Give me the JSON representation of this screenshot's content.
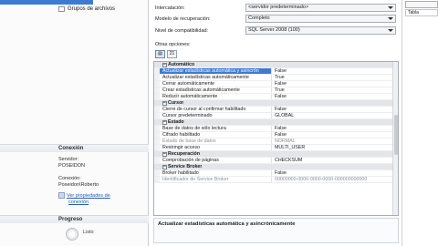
{
  "left": {
    "pages": [
      {
        "label": "",
        "selected": true
      },
      {
        "label": "Grupos de archivos",
        "selected": false
      }
    ],
    "connection": {
      "heading": "Conexión",
      "server_label": "Servidor:",
      "server_value": "POSEIDON",
      "conn_label": "Conexión:",
      "conn_value": "Poseidon\\Roberto",
      "view_props_link_line1": "Ver propiedades de",
      "view_props_link_line2": "conexión"
    },
    "progress": {
      "heading": "Progreso",
      "status": "Listo"
    }
  },
  "fields": {
    "collation_label": "Intercalación:",
    "collation_value": "<servidor predeterminado>",
    "recovery_label": "Modelo de recuperación:",
    "recovery_value": "Completo",
    "compat_label": "Nivel de compatibilidad:",
    "compat_value": "SQL Server 2008 (100)",
    "other_options_label": "Otras opciones:"
  },
  "toolbar": {
    "categorized_icon_label": "",
    "alpha_sort_label": "21"
  },
  "grid": {
    "sections": [
      {
        "title": "Automático",
        "rows": [
          {
            "name": "Actualizar estadísticas automática y asincrón",
            "value": "False",
            "selected": true
          },
          {
            "name": "Actualizar estadísticas automáticamente",
            "value": "True"
          },
          {
            "name": "Cerrar automáticamente",
            "value": "False"
          },
          {
            "name": "Crear estadísticas automáticamente",
            "value": "True"
          },
          {
            "name": "Reducir automáticamente",
            "value": "False"
          }
        ]
      },
      {
        "title": "Cursor",
        "rows": [
          {
            "name": "Cierre de cursor al confirmar habilitado",
            "value": "False"
          },
          {
            "name": "Cursor predeterminado",
            "value": "GLOBAL"
          }
        ]
      },
      {
        "title": "Estado",
        "rows": [
          {
            "name": "Base de datos de sólo lectura",
            "value": "False"
          },
          {
            "name": "Cifrado habilitado",
            "value": "False"
          },
          {
            "name": "Estado de base de datos",
            "value": "NORMAL",
            "grey": true
          },
          {
            "name": "Restringir acceso",
            "value": "MULTI_USER"
          }
        ]
      },
      {
        "title": "Recuperación",
        "rows": [
          {
            "name": "Comprobación de páginas",
            "value": "CHECKSUM"
          }
        ]
      },
      {
        "title": "Service Broker",
        "rows": [
          {
            "name": "Broker habilitado",
            "value": "False"
          },
          {
            "name": "Identificador de Service Broker",
            "value": "00000000-0000-0000-0000-000000000000",
            "grey": true
          }
        ]
      }
    ]
  },
  "description": "Actualizar estadísticas automática y asincrónicamente",
  "strip": {
    "button1": "",
    "button2": "Tabla"
  }
}
